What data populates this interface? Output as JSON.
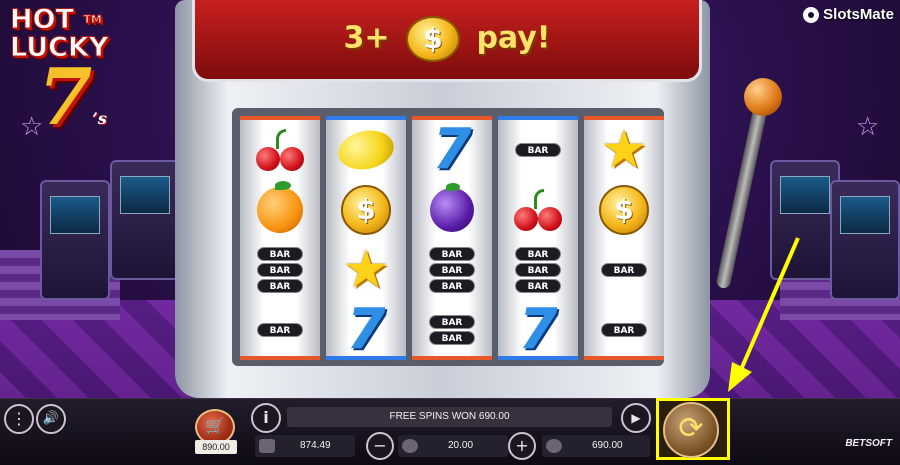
{
  "game": {
    "logo": {
      "line1": "HOT",
      "line2": "LUCKY",
      "seven": "7",
      "suffix": "’s",
      "tm": "TM"
    },
    "site_brand": "SlotsMate",
    "banner": {
      "prefix": "3+",
      "coin_symbol": "$",
      "suffix": "pay!"
    }
  },
  "reels": [
    [
      "cherry",
      "orange",
      "bar-3",
      "bar-1"
    ],
    [
      "lemon",
      "coin",
      "star",
      "seven"
    ],
    [
      "seven",
      "plum",
      "bar-3",
      "bar-2"
    ],
    [
      "bar-1",
      "cherry",
      "bar-3",
      "seven"
    ],
    [
      "star",
      "coin",
      "bar-1",
      "bar-1"
    ]
  ],
  "symbol_text": {
    "bar": "BAR",
    "coin": "$",
    "seven": "7",
    "star": "★"
  },
  "panel": {
    "menu_icon": "⋮",
    "sound_icon": "🔊",
    "buy_icon": "🛒",
    "buy_value": "890.00",
    "info_icon": "i",
    "message": "FREE SPINS WON 690.00",
    "autoplay_icon": "▶",
    "balance": "874.49",
    "minus_icon": "−",
    "bet": "20.00",
    "plus_icon": "+",
    "win": "690.00",
    "spin_icon": "⟳",
    "provider": "BETSOFT"
  },
  "colors": {
    "highlight": "#ffff00",
    "reel_orange": "#e8572a",
    "reel_blue": "#2d7ae8"
  }
}
